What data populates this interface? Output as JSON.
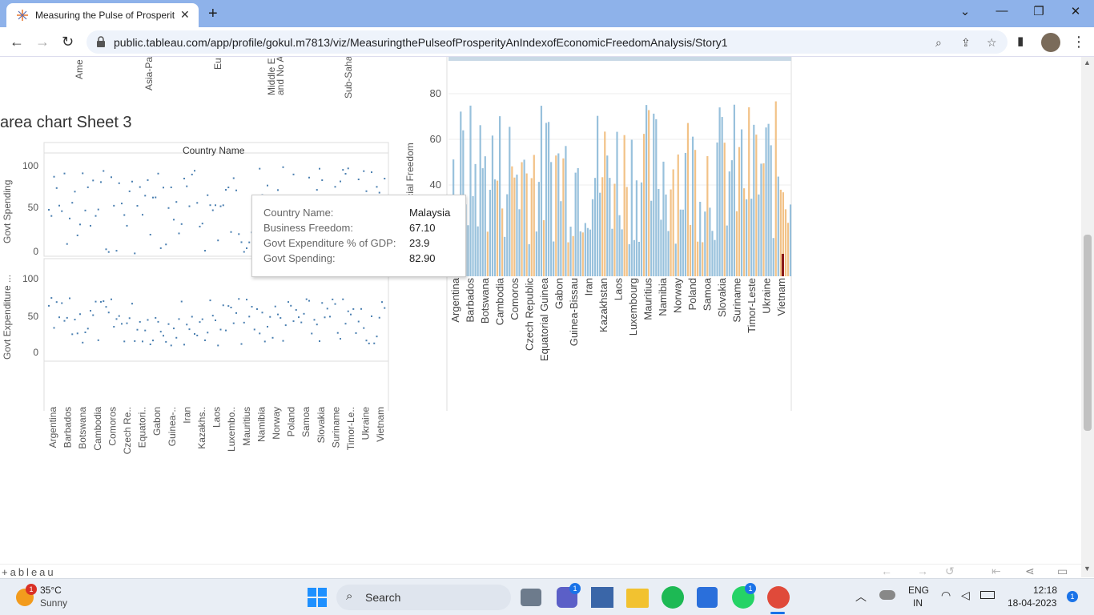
{
  "browser": {
    "tab_title": "Measuring the Pulse of Prosperit",
    "close": "✕",
    "new_tab": "+",
    "url": "public.tableau.com/app/profile/gokul.m7813/viz/MeasuringthePulseofProsperityAnIndexofEconomicFreedomAnalysis/Story1",
    "win_controls": [
      "⌄",
      "—",
      "❐",
      "✕"
    ]
  },
  "viz": {
    "top_region_labels": [
      "Ame",
      "Asia-Pa",
      "Eu",
      "Middle E and No A",
      "Sub-Saha A"
    ],
    "sheet_title": "area chart  Sheet 3",
    "column_header": "Country Name",
    "top_ylabel": "Govt Spending",
    "bottom_ylabel": "Govt Expenditure ...",
    "top_yticks": [
      "100",
      "50",
      "0"
    ],
    "bottom_yticks": [
      "100",
      "50",
      "0"
    ],
    "left_countries": [
      "Argentina",
      "Barbados",
      "Botswana",
      "Cambodia",
      "Comoros",
      "Czech Re..",
      "Equatori..",
      "Gabon",
      "Guinea-..",
      "Iran",
      "Kazakhs..",
      "Laos",
      "Luxembo..",
      "Mauritius",
      "Namibia",
      "Norway",
      "Poland",
      "Samoa",
      "Slovakia",
      "Suriname",
      "Timor-Le..",
      "Ukraine",
      "Vietnam"
    ],
    "right_ylabel": "ancial Freedom",
    "right_yticks": [
      "80",
      "60",
      "40"
    ],
    "right_countries": [
      "Argentina",
      "Barbados",
      "Botswana",
      "Cambodia",
      "Comoros",
      "Czech Republic",
      "Equatorial Guinea",
      "Gabon",
      "Guinea-Bissau",
      "Iran",
      "Kazakhstan",
      "Laos",
      "Luxembourg",
      "Mauritius",
      "Namibia",
      "Norway",
      "Poland",
      "Samoa",
      "Slovakia",
      "Suriname",
      "Timor-Leste",
      "Ukraine",
      "Vietnam"
    ]
  },
  "tooltip": {
    "rows": [
      {
        "label": "Country Name:",
        "value": "Malaysia"
      },
      {
        "label": "Business Freedom:",
        "value": "67.10"
      },
      {
        "label": "Govt Expenditure % of GDP:",
        "value": "23.9"
      },
      {
        "label": "Govt Spending:",
        "value": "82.90"
      }
    ]
  },
  "footer": {
    "logo": "+ableau"
  },
  "taskbar": {
    "weather_temp": "35°C",
    "weather_desc": "Sunny",
    "weather_badge": "1",
    "search": "Search",
    "lang1": "ENG",
    "lang2": "IN",
    "time": "12:18",
    "date": "18-04-2023",
    "notif": "1",
    "teams_badge": "1",
    "whatsapp_badge": "1"
  },
  "colors": {
    "accent_blue": "#86b6d6",
    "orange": "#f0b772",
    "dark_red": "#8b1a1a",
    "titlebar": "#8eb2ea"
  }
}
